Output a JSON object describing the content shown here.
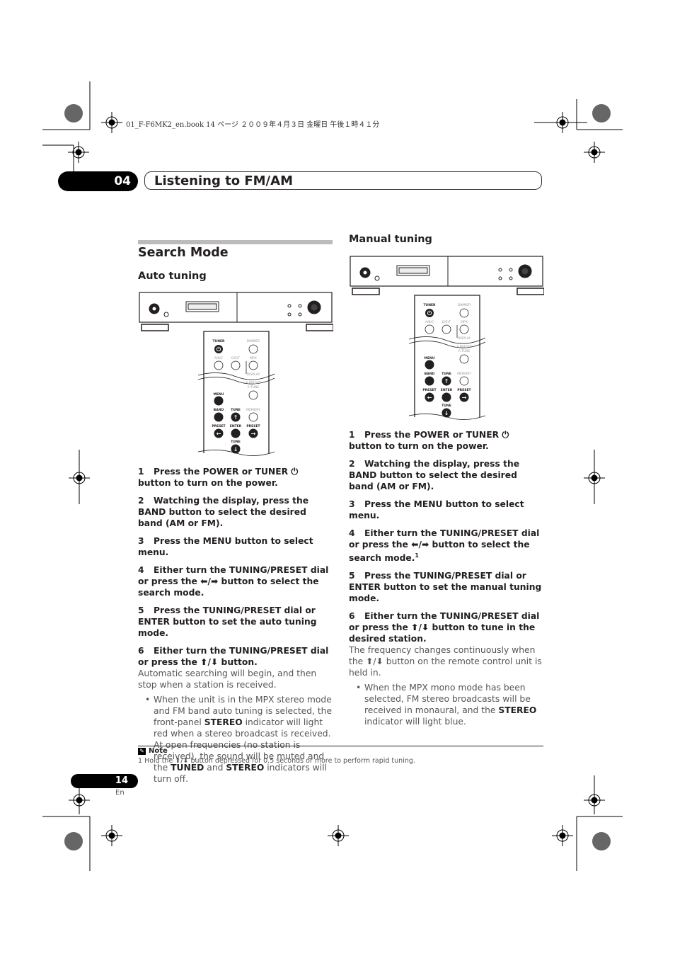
{
  "header": {
    "file_line": "01_F-F6MK2_en.book  14 ページ  ２００９年４月３日  金曜日  午後１時４１分"
  },
  "chapter": {
    "number": "04",
    "title": "Listening to FM/AM"
  },
  "left": {
    "heading": "Search Mode",
    "subheading": "Auto tuning",
    "steps": [
      {
        "n": "1",
        "text": "Press the POWER or TUNER ⏻ button to turn on the power."
      },
      {
        "n": "2",
        "text": "Watching the display, press the BAND button to select the desired band (AM or FM)."
      },
      {
        "n": "3",
        "text": "Press the MENU button to select menu."
      },
      {
        "n": "4",
        "text": "Either turn the TUNING/PRESET dial or press the ⬅/➡ button to select the search mode."
      },
      {
        "n": "5",
        "text": "Press the TUNING/PRESET dial or ENTER button to set the auto tuning mode."
      },
      {
        "n": "6",
        "text": "Either turn the TUNING/PRESET dial or press the ⬆/⬇ button."
      }
    ],
    "body": "Automatic searching will begin, and then stop when a station is received.",
    "bullet": [
      {
        "t": "When the unit is in the MPX stereo mode and FM band auto tuning is selected, the front-panel "
      },
      {
        "t": "STEREO",
        "b": true
      },
      {
        "t": " indicator will light red when a stereo broadcast is received. At open frequencies (no station is received), the sound will be muted and the "
      },
      {
        "t": "TUNED",
        "b": true
      },
      {
        "t": " and "
      },
      {
        "t": "STEREO",
        "b": true
      },
      {
        "t": " indicators will turn off."
      }
    ]
  },
  "right": {
    "heading": "Manual tuning",
    "steps": [
      {
        "n": "1",
        "text": "Press the POWER or TUNER ⏻ button to turn on the power."
      },
      {
        "n": "2",
        "text": "Watching the display, press the BAND button to select the desired band (AM or FM)."
      },
      {
        "n": "3",
        "text": "Press the MENU button to select menu."
      },
      {
        "n": "4",
        "text": "Either turn the TUNING/PRESET dial or press the ⬅/➡ button to select the search mode.",
        "sup": "1"
      },
      {
        "n": "5",
        "text": "Press the TUNING/PRESET dial or ENTER button to set the manual tuning mode."
      },
      {
        "n": "6",
        "text": "Either turn the TUNING/PRESET dial or press the ⬆/⬇ button to tune in the desired station."
      }
    ],
    "body": "The frequency changes continuously when the ⬆/⬇ button on the remote control unit is held in.",
    "bullet": [
      {
        "t": "When the MPX mono mode has been selected, FM stereo broadcasts will be received in monaural, and the "
      },
      {
        "t": "STEREO",
        "b": true
      },
      {
        "t": " indicator will light blue."
      }
    ]
  },
  "remote": {
    "tuner": "TUNER",
    "dimmer": "DIMMER",
    "abc": "A/B/C",
    "def": "D/E/F",
    "mpx": "MPX",
    "display": "DISPLAY",
    "apreset": "A.PRESET",
    "atune": "A.TUNE",
    "menu": "MENU",
    "band": "BAND",
    "tune_up": "TUNE",
    "memory": "MEMORY",
    "preset_left": "PRESET",
    "enter": "ENTER",
    "preset_right": "PRESET",
    "tune_down": "TUNE"
  },
  "note": {
    "title": "Note",
    "text": "1 Hold the ⬆/⬇ button depressed for 0.5 seconds or more to perform rapid tuning."
  },
  "footer": {
    "page": "14",
    "lang": "En"
  }
}
